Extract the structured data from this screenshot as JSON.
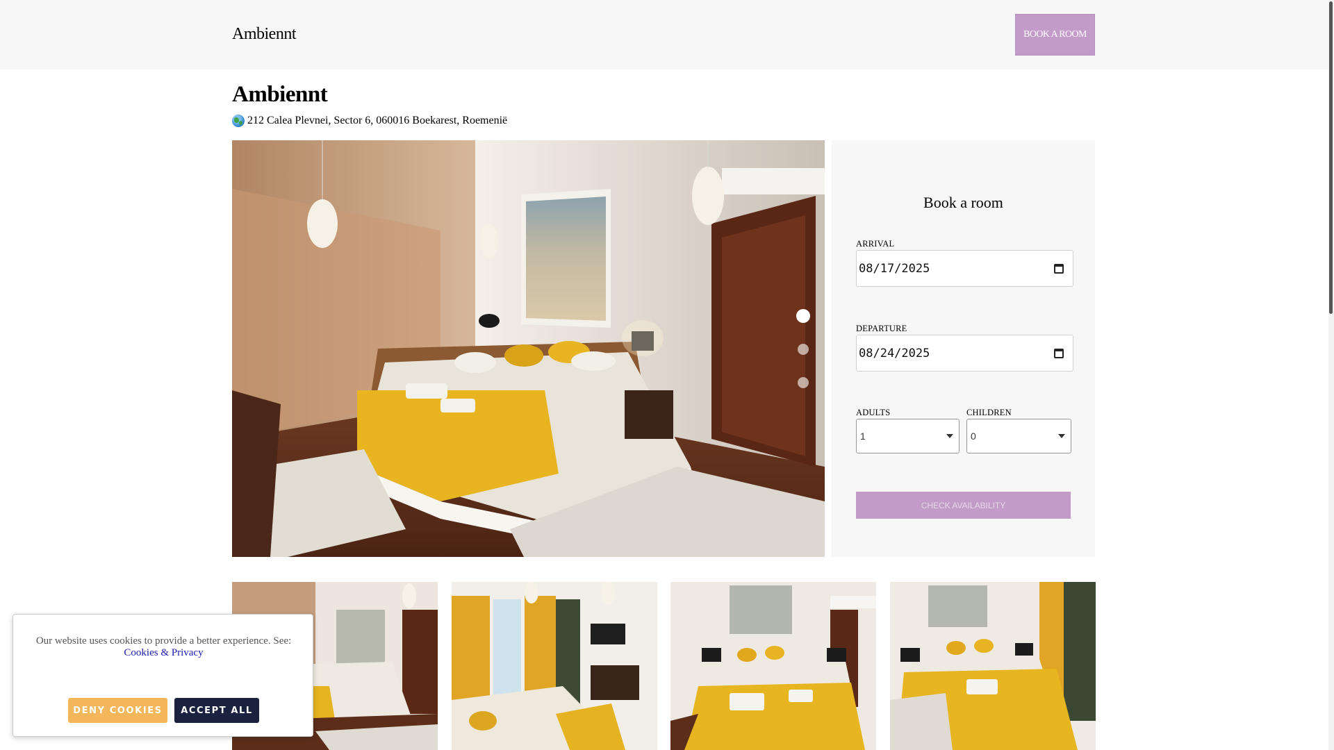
{
  "header": {
    "brand": "Ambiennt",
    "book_button": "BOOK A ROOM"
  },
  "hotel": {
    "name": "Ambiennt",
    "address": "212 Calea Plevnei, Sector 6, 060016 Boekarest, Roemenië",
    "address_icon": "globe-icon"
  },
  "gallery": {
    "slides_count": 3,
    "active_slide": 1,
    "main_image_alt": "Hotel room with yellow bedspread",
    "thumbnails": [
      "room-photo-1",
      "room-photo-2",
      "room-photo-3",
      "room-photo-4"
    ]
  },
  "booking": {
    "title": "Book a room",
    "arrival_label": "ARRIVAL",
    "arrival_value": "08/17/2025",
    "departure_label": "DEPARTURE",
    "departure_value": "08/24/2025",
    "adults_label": "ADULTS",
    "adults_value": "1",
    "children_label": "CHILDREN",
    "children_value": "0",
    "check_button": "CHECK AVAILABILITY"
  },
  "cookies": {
    "text": "Our website uses cookies to provide a better experience. See:",
    "link": "Cookies & Privacy",
    "deny": "DENY COOKIES",
    "accept": "ACCEPT ALL"
  },
  "colors": {
    "accent": "#c39bc9",
    "header_bg": "#f7f7f7",
    "deny": "#f4b65a",
    "accept": "#1b2240"
  }
}
